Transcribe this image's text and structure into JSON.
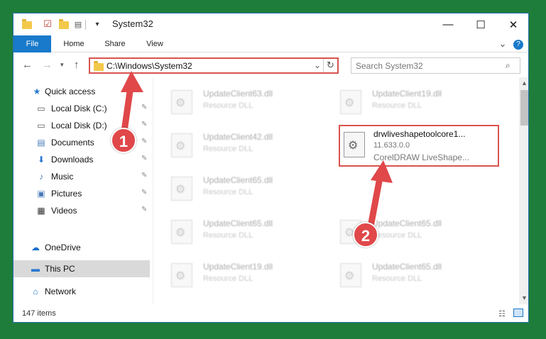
{
  "window": {
    "title": "System32",
    "controls": {
      "minimize": "—",
      "maximize": "☐",
      "close": "✕"
    }
  },
  "ribbon": {
    "tabs": [
      {
        "label": "File"
      },
      {
        "label": "Home"
      },
      {
        "label": "Share"
      },
      {
        "label": "View"
      }
    ],
    "expand_icon": "⌄",
    "help_icon": "?"
  },
  "address": {
    "path": "C:\\Windows\\System32",
    "search_placeholder": "Search System32"
  },
  "nav_pane": {
    "items": [
      {
        "label": "Quick access",
        "icon": "★",
        "icon_color": "#2b79d0",
        "pinned": false
      },
      {
        "label": "Local Disk (C:)",
        "icon": "▭",
        "icon_color": "#555",
        "pinned": true
      },
      {
        "label": "Local Disk (D:)",
        "icon": "▭",
        "icon_color": "#555",
        "pinned": true
      },
      {
        "label": "Documents",
        "icon": "▤",
        "icon_color": "#4a7ab8",
        "pinned": true
      },
      {
        "label": "Downloads",
        "icon": "⬇",
        "icon_color": "#2b79d0",
        "pinned": true
      },
      {
        "label": "Music",
        "icon": "♪",
        "icon_color": "#4a7ab8",
        "pinned": true
      },
      {
        "label": "Pictures",
        "icon": "▣",
        "icon_color": "#4a7ab8",
        "pinned": true
      },
      {
        "label": "Videos",
        "icon": "▦",
        "icon_color": "#333",
        "pinned": true
      },
      {
        "label": "OneDrive",
        "icon": "☁",
        "icon_color": "#1a6fc9",
        "pinned": false
      },
      {
        "label": "This PC",
        "icon": "▬",
        "icon_color": "#2b79d0",
        "pinned": false,
        "selected": true
      },
      {
        "label": "Network",
        "icon": "⌂",
        "icon_color": "#2b79d0",
        "pinned": false
      }
    ],
    "pin_glyph": "📌"
  },
  "files": {
    "left_column": [
      {
        "name": "UpdateClient63.dll",
        "type": "Resource DLL"
      },
      {
        "name": "UpdateClient42.dll",
        "type": "Resource DLL"
      },
      {
        "name": "UpdateClient65.dll",
        "type": "Resource DLL"
      },
      {
        "name": "UpdateClient65.dll",
        "type": "Resource DLL"
      },
      {
        "name": "UpdateClient19.dll",
        "type": "Resource DLL"
      }
    ],
    "right_column": [
      {
        "name": "UpdateClient19.dll",
        "type": "Resource DLL"
      },
      {
        "name": "UpdateClient65.dll",
        "type": "Resource DLL"
      },
      {
        "name": "UpdateClient65.dll",
        "type": "Resource DLL"
      }
    ],
    "highlighted": {
      "name": "drwliveshapetoolcore1...",
      "version": "11.633.0.0",
      "description": "CorelDRAW LiveShape..."
    }
  },
  "status": {
    "item_count": "147 items"
  },
  "callouts": {
    "one": "1",
    "two": "2"
  },
  "colors": {
    "callout": "#e0484a",
    "highlight_border": "#d9534f",
    "accent": "#1979ca"
  }
}
